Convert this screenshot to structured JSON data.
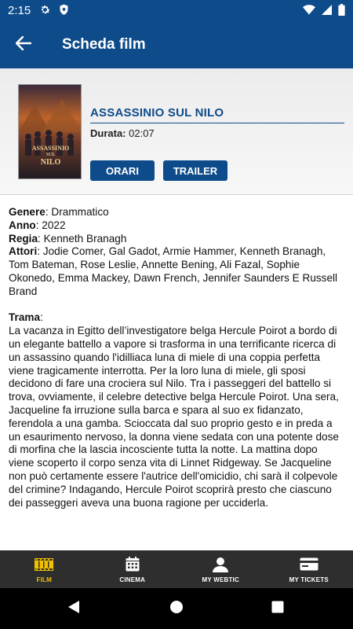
{
  "status_bar": {
    "time": "2:15"
  },
  "app_bar": {
    "title": "Scheda film"
  },
  "movie": {
    "title": "ASSASSINIO SUL NILO",
    "duration_label": "Durata:",
    "duration_value": " 02:07",
    "poster_text_line1": "ASSASSINIO",
    "poster_text_line2": "SUL",
    "poster_text_line3": "NILO",
    "buttons": {
      "orari": "ORARI",
      "trailer": "TRAILER"
    }
  },
  "details": {
    "genre_label": "Genere",
    "genre_value": ": Drammatico",
    "year_label": "Anno",
    "year_value": ": 2022",
    "director_label": "Regia",
    "director_value": ": Kenneth Branagh",
    "cast_label": "Attori",
    "cast_value": ": Jodie Comer, Gal Gadot, Armie Hammer, Kenneth Branagh, Tom Bateman, Rose Leslie, Annette Bening, Ali Fazal, Sophie Okonedo, Emma Mackey, Dawn French, Jennifer Saunders E Russell Brand",
    "plot_label": "Trama",
    "plot_colon": ":",
    "plot_value": "La vacanza in Egitto dell’investigatore belga Hercule Poirot a bordo di un elegante battello a vapore si trasforma in una terrificante ricerca di un assassino quando l'idilliaca luna di miele di una coppia perfetta viene tragicamente interrotta. Per la loro luna di miele, gli sposi decidono di fare una crociera sul Nilo. Tra i passeggeri del battello si trova, ovviamente, il celebre detective belga Hercule Poirot. Una sera, Jacqueline fa irruzione sulla barca e spara al suo ex fidanzato, ferendola a una gamba. Scioccata dal suo proprio gesto e in preda a un esaurimento nervoso, la donna viene sedata con una potente dose di morfina che la lascia incosciente tutta la notte. La mattina dopo viene scoperto il corpo senza vita di Linnet Ridgeway. Se Jacqueline non può certamente essere l'autrice dell'omicidio, chi sarà il colpevole del crimine? Indagando, Hercule Poirot scoprirà presto che ciascuno dei passeggeri aveva una buona ragione per ucciderla."
  },
  "bottom_nav": {
    "items": [
      {
        "label": "FILM",
        "icon": "film-icon",
        "active": true
      },
      {
        "label": "CINEMA",
        "icon": "calendar-icon",
        "active": false
      },
      {
        "label": "MY WEBTIC",
        "icon": "person-icon",
        "active": false
      },
      {
        "label": "MY TICKETS",
        "icon": "card-icon",
        "active": false
      }
    ]
  },
  "colors": {
    "primary": "#0e4b8a",
    "accent": "#f2c200",
    "nav_background": "#2e2e2e"
  }
}
